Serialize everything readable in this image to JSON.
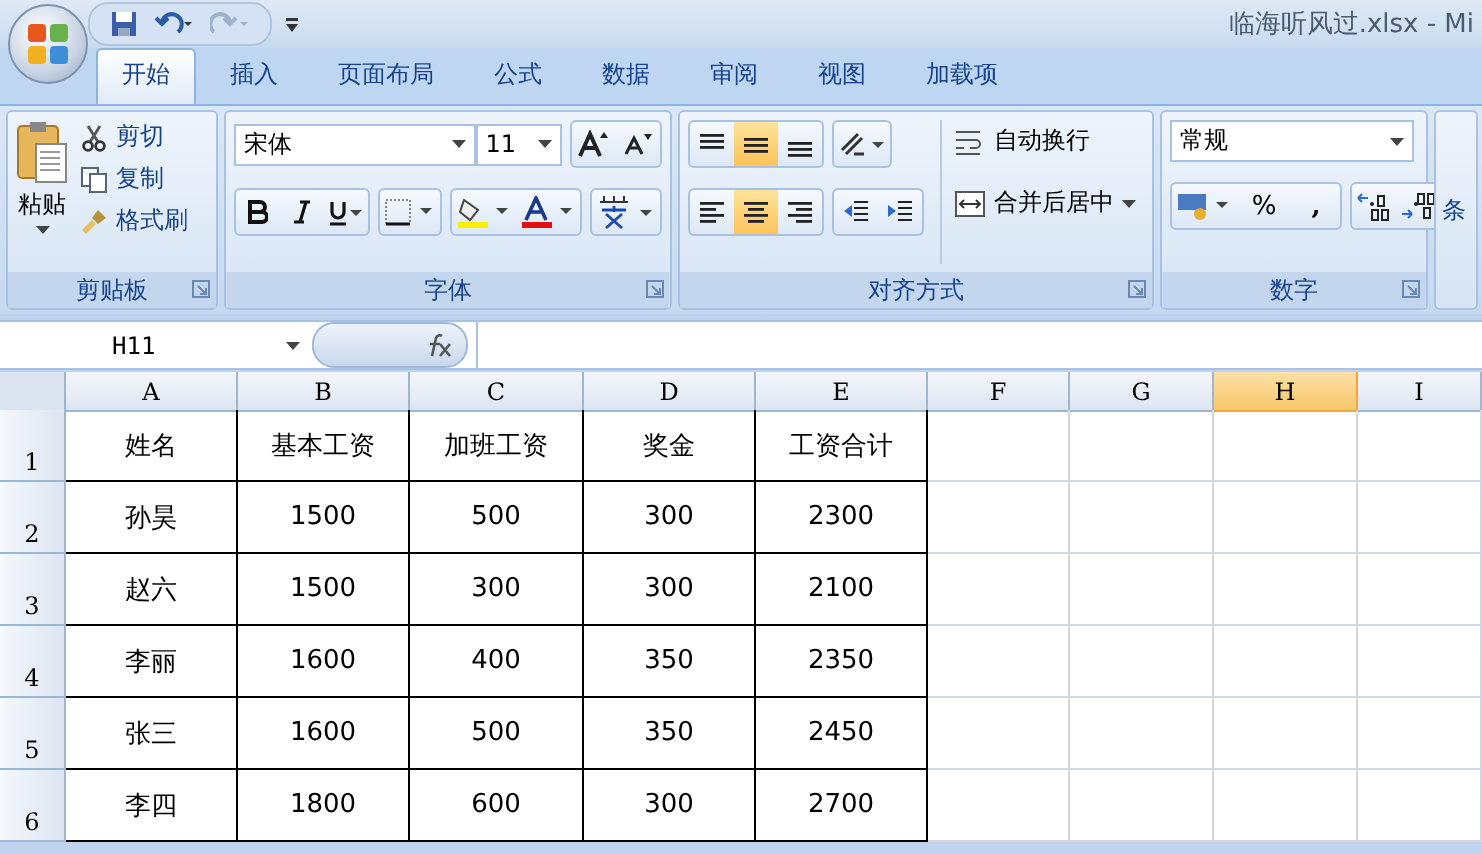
{
  "window": {
    "title": "临海听风过.xlsx - Mi"
  },
  "tabs": [
    {
      "label": "开始",
      "selected": true
    },
    {
      "label": "插入",
      "selected": false
    },
    {
      "label": "页面布局",
      "selected": false
    },
    {
      "label": "公式",
      "selected": false
    },
    {
      "label": "数据",
      "selected": false
    },
    {
      "label": "审阅",
      "selected": false
    },
    {
      "label": "视图",
      "selected": false
    },
    {
      "label": "加载项",
      "selected": false
    }
  ],
  "clipboard": {
    "paste": "粘贴",
    "cut": "剪切",
    "copy": "复制",
    "format_painter": "格式刷",
    "title": "剪贴板"
  },
  "font": {
    "font_name": "宋体",
    "font_size": "11",
    "title": "字体"
  },
  "alignment": {
    "vertical": [
      {
        "kind": "top",
        "selected": false
      },
      {
        "kind": "middle",
        "selected": true
      },
      {
        "kind": "bottom",
        "selected": false
      }
    ],
    "horizontal": [
      {
        "kind": "left",
        "selected": false
      },
      {
        "kind": "center",
        "selected": true
      },
      {
        "kind": "right",
        "selected": false
      }
    ],
    "wrap": "自动换行",
    "merge": "合并后居中",
    "title": "对齐方式"
  },
  "number": {
    "format": "常规",
    "percent": "%",
    "comma": ",",
    "title": "数字"
  },
  "next_group_partial": "条",
  "name_box": "H11",
  "columns": [
    {
      "label": "A",
      "selected": false
    },
    {
      "label": "B",
      "selected": false
    },
    {
      "label": "C",
      "selected": false
    },
    {
      "label": "D",
      "selected": false
    },
    {
      "label": "E",
      "selected": false
    },
    {
      "label": "F",
      "selected": false
    },
    {
      "label": "G",
      "selected": false
    },
    {
      "label": "H",
      "selected": true
    },
    {
      "label": "I",
      "selected": false
    }
  ],
  "rows": [
    {
      "number": "1",
      "cells": [
        "姓名",
        "基本工资",
        "加班工资",
        "奖金",
        "工资合计"
      ]
    },
    {
      "number": "2",
      "cells": [
        "孙昊",
        "1500",
        "500",
        "300",
        "2300"
      ]
    },
    {
      "number": "3",
      "cells": [
        "赵六",
        "1500",
        "300",
        "300",
        "2100"
      ]
    },
    {
      "number": "4",
      "cells": [
        "李丽",
        "1600",
        "400",
        "350",
        "2350"
      ]
    },
    {
      "number": "5",
      "cells": [
        "张三",
        "1600",
        "500",
        "350",
        "2450"
      ]
    },
    {
      "number": "6",
      "cells": [
        "李四",
        "1800",
        "600",
        "300",
        "2700"
      ]
    }
  ]
}
